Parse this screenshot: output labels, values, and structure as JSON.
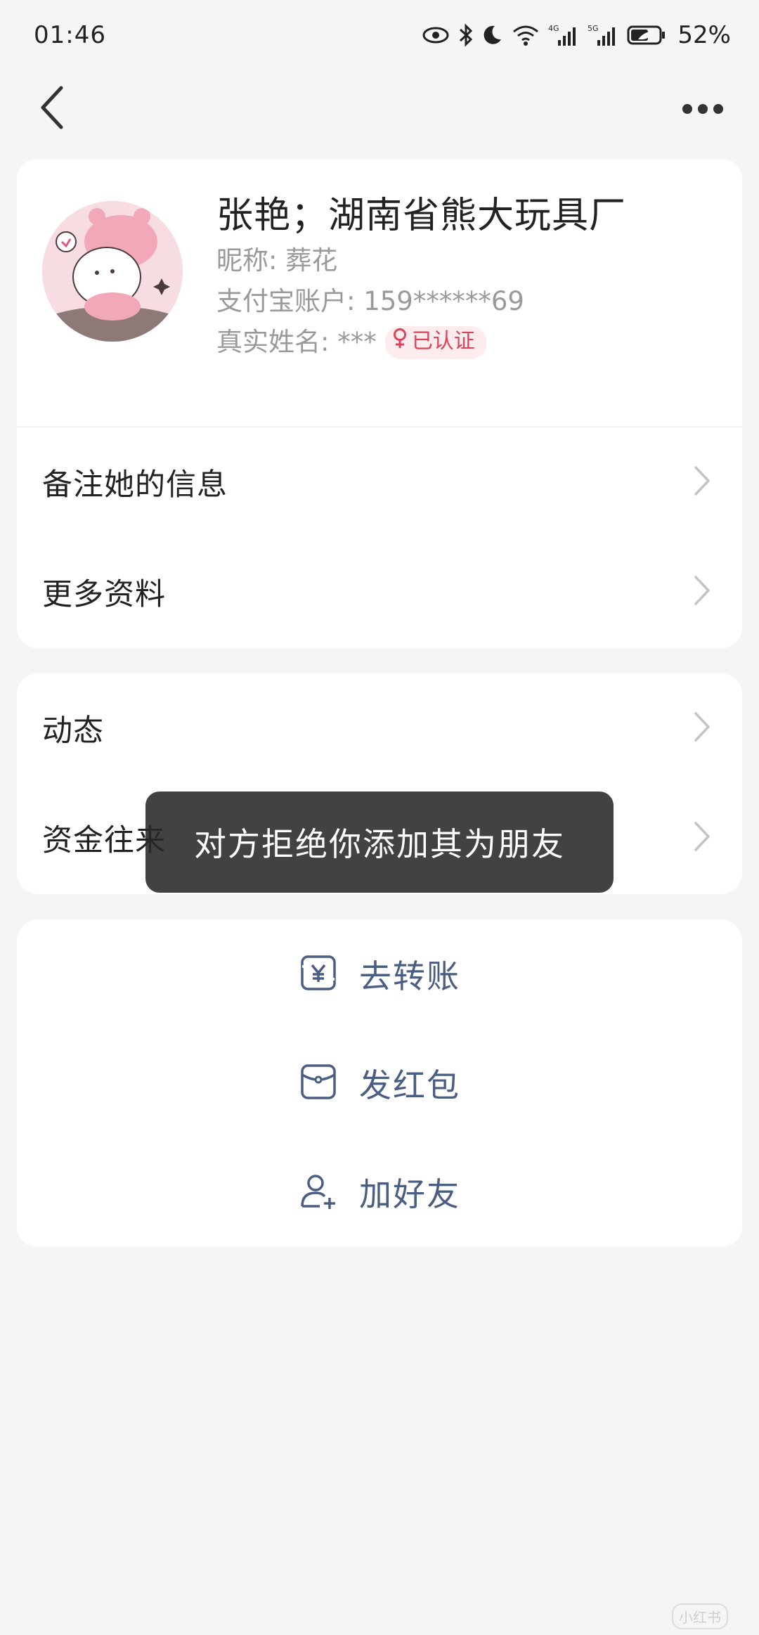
{
  "status_bar": {
    "time": "01:46",
    "battery": "52%",
    "network_1": "4G",
    "network_2": "5G",
    "icons": [
      "eye-icon",
      "bluetooth-icon",
      "moon-icon",
      "wifi-icon",
      "signal-icon",
      "battery-icon"
    ]
  },
  "nav": {
    "back_icon": "chevron-left-icon",
    "more_icon": "more-dots-icon"
  },
  "profile": {
    "name": "张艳；湖南省熊大玩具厂",
    "nickname": "昵称: 葬花",
    "alipay_account": "支付宝账户: 159******69",
    "real_name": "真实姓名: ***",
    "verified_label": "已认证",
    "verified_color": "#d9435b"
  },
  "menu_primary": {
    "items": [
      {
        "label": "备注她的信息"
      },
      {
        "label": "更多资料"
      }
    ]
  },
  "menu_secondary": {
    "items": [
      {
        "label": "动态"
      },
      {
        "label": "资金往来"
      }
    ]
  },
  "actions": {
    "items": [
      {
        "label": "去转账",
        "icon": "transfer-yuan-icon"
      },
      {
        "label": "发红包",
        "icon": "red-envelope-icon"
      },
      {
        "label": "加好友",
        "icon": "add-friend-icon"
      }
    ],
    "color": "#4a5d82"
  },
  "toast": {
    "message": "对方拒绝你添加其为朋友"
  },
  "watermark": {
    "text": "小红书"
  }
}
